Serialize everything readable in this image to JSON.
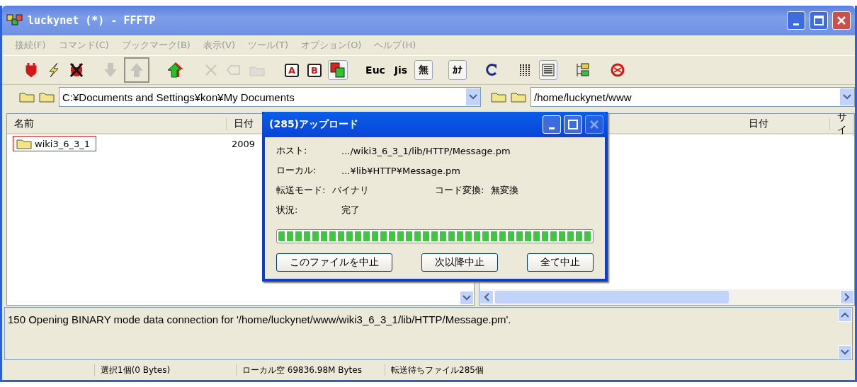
{
  "window": {
    "title": "luckynet (*) - FFFTP"
  },
  "menu": [
    "接続(F)",
    "コマンド(C)",
    "ブックマーク(B)",
    "表示(V)",
    "ツール(T)",
    "オプション(O)",
    "ヘルプ(H)"
  ],
  "toolbar": [
    {
      "kind": "plug",
      "disabled": false,
      "pressed": false,
      "highlighted": false
    },
    {
      "kind": "bolt",
      "disabled": false,
      "pressed": false,
      "highlighted": false
    },
    {
      "kind": "unplug",
      "disabled": false,
      "pressed": false,
      "highlighted": false
    },
    {
      "kind": "gap"
    },
    {
      "kind": "down",
      "disabled": true,
      "pressed": false,
      "highlighted": false
    },
    {
      "kind": "up",
      "disabled": true,
      "pressed": false,
      "highlighted": true
    },
    {
      "kind": "gap"
    },
    {
      "kind": "mirror",
      "disabled": false,
      "pressed": false,
      "highlighted": false
    },
    {
      "kind": "gap"
    },
    {
      "kind": "delete",
      "disabled": true,
      "pressed": false,
      "highlighted": false
    },
    {
      "kind": "rename",
      "disabled": true,
      "pressed": false,
      "highlighted": false
    },
    {
      "kind": "mkdir",
      "disabled": true,
      "pressed": false,
      "highlighted": false
    },
    {
      "kind": "gap"
    },
    {
      "kind": "letter",
      "label": "A",
      "disabled": false,
      "pressed": false,
      "highlighted": false
    },
    {
      "kind": "letter",
      "label": "B",
      "disabled": false,
      "pressed": false,
      "highlighted": false
    },
    {
      "kind": "pair",
      "disabled": false,
      "pressed": true,
      "highlighted": false
    },
    {
      "kind": "gap"
    },
    {
      "kind": "text",
      "label": "Euc",
      "disabled": false,
      "pressed": false,
      "highlighted": false
    },
    {
      "kind": "text",
      "label": "Jis",
      "disabled": false,
      "pressed": false,
      "highlighted": false
    },
    {
      "kind": "text",
      "label": "無",
      "disabled": false,
      "pressed": true,
      "highlighted": false
    },
    {
      "kind": "gap"
    },
    {
      "kind": "text",
      "label": "ｶﾅ",
      "disabled": false,
      "pressed": true,
      "highlighted": false
    },
    {
      "kind": "gap"
    },
    {
      "kind": "refresh",
      "disabled": false,
      "pressed": false,
      "highlighted": false
    },
    {
      "kind": "gap"
    },
    {
      "kind": "list",
      "disabled": false,
      "pressed": false,
      "highlighted": false
    },
    {
      "kind": "detail",
      "disabled": false,
      "pressed": true,
      "highlighted": false
    },
    {
      "kind": "gap"
    },
    {
      "kind": "tree",
      "disabled": false,
      "pressed": false,
      "highlighted": false
    },
    {
      "kind": "gap"
    },
    {
      "kind": "stop",
      "disabled": false,
      "pressed": false,
      "highlighted": false
    }
  ],
  "local": {
    "path": "C:¥Documents and Settings¥kon¥My Documents",
    "columns": [
      "名前",
      "日付"
    ],
    "rows": [
      {
        "name": "wiki3_6_3_1",
        "date": "2009",
        "highlighted": true
      }
    ]
  },
  "remote": {
    "path": "/home/luckynet/www",
    "columns": [
      "日付",
      "サイ"
    ]
  },
  "dialog": {
    "title": "(285)アップロード",
    "fields": [
      {
        "label": "ホスト:",
        "value": ".../wiki3_6_3_1/lib/HTTP/Message.pm"
      },
      {
        "label": "ローカル:",
        "value": "...¥lib¥HTTP¥Message.pm"
      },
      {
        "label": "転送モード:",
        "value": "バイナリ",
        "extra_label": "コード変換:",
        "extra_value": "無変換"
      },
      {
        "label": "状況:",
        "value": "完了"
      }
    ],
    "progress": {
      "level": 1
    },
    "buttons": [
      "このファイルを中止",
      "次以降中止",
      "全て中止"
    ]
  },
  "log": "150 Opening BINARY mode data connection for '/home/luckynet/www/wiki3_6_3_1/lib/HTTP/Message.pm'.",
  "status_bar": [
    "選択1個(0 Bytes)",
    "ローカル空 69836.98M Bytes",
    "転送待ちファイル285個"
  ]
}
